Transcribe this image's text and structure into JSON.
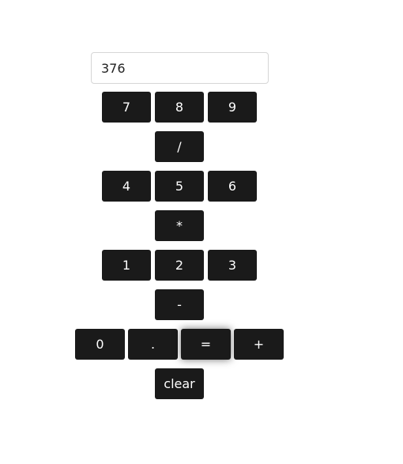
{
  "display": {
    "value": "376"
  },
  "keys": {
    "seven": "7",
    "eight": "8",
    "nine": "9",
    "divide": "/",
    "four": "4",
    "five": "5",
    "six": "6",
    "multiply": "*",
    "one": "1",
    "two": "2",
    "three": "3",
    "subtract": "-",
    "zero": "0",
    "decimal": ".",
    "equals": "=",
    "add": "+",
    "clear": "clear"
  },
  "colors": {
    "key_background": "#1a1a1a",
    "key_text": "#ffffff",
    "display_border": "#d6d6d6"
  }
}
